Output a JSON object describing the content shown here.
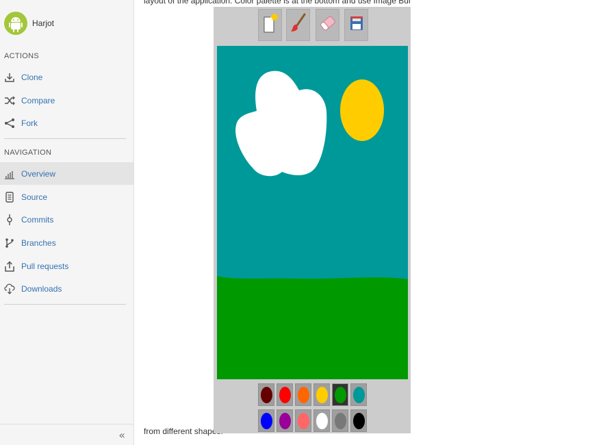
{
  "user": {
    "name": "Harjot",
    "avatar": "android-icon"
  },
  "sidebar": {
    "actions_title": "ACTIONS",
    "actions": [
      {
        "label": "Clone",
        "icon": "download-icon"
      },
      {
        "label": "Compare",
        "icon": "shuffle-icon"
      },
      {
        "label": "Fork",
        "icon": "fork-icon"
      }
    ],
    "navigation_title": "NAVIGATION",
    "navigation": [
      {
        "label": "Overview",
        "icon": "bar-chart-icon",
        "active": true
      },
      {
        "label": "Source",
        "icon": "file-icon"
      },
      {
        "label": "Commits",
        "icon": "commit-icon"
      },
      {
        "label": "Branches",
        "icon": "branch-icon"
      },
      {
        "label": "Pull requests",
        "icon": "upload-icon"
      },
      {
        "label": "Downloads",
        "icon": "cloud-download-icon"
      }
    ],
    "collapse_label": "«"
  },
  "content": {
    "text_top": "layout of the application. Color palette is at the bottom and use Image Button to select",
    "text_bottom": "from different shapes."
  },
  "app": {
    "tools": [
      {
        "name": "new-drawing-icon"
      },
      {
        "name": "brush-icon"
      },
      {
        "name": "eraser-icon"
      },
      {
        "name": "save-icon"
      }
    ],
    "canvas_colors": {
      "sky": "#009999",
      "grass": "#009900",
      "cloud": "#ffffff",
      "sun": "#ffcc00"
    },
    "palette": [
      [
        "#660000",
        "#ff0000",
        "#ff6600",
        "#ffcc00",
        "#009900",
        "#009999"
      ],
      [
        "#0000ff",
        "#990099",
        "#ff6666",
        "#ffffff",
        "#787878",
        "#000000"
      ]
    ],
    "selected_color": "#009900"
  }
}
